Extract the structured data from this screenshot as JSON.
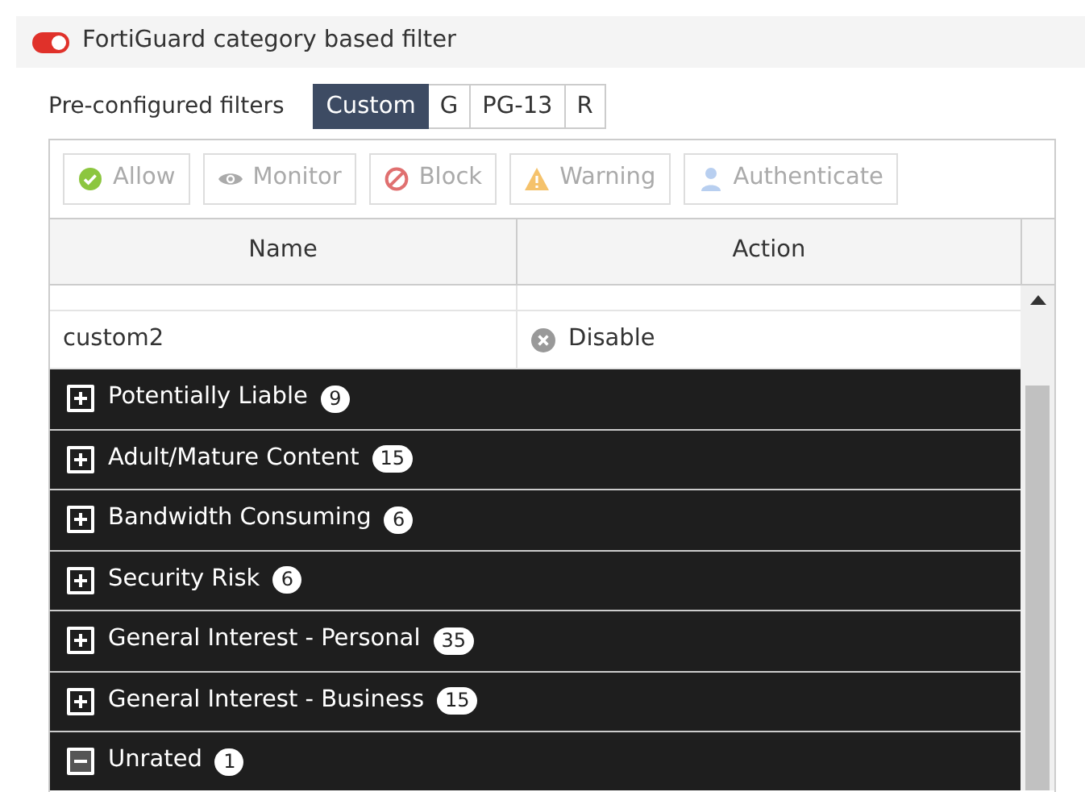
{
  "filter_toggle": {
    "label": "FortiGuard category based filter",
    "on": true
  },
  "preconfigured": {
    "label": "Pre-configured filters",
    "options": [
      {
        "label": "Custom",
        "selected": true
      },
      {
        "label": "G",
        "selected": false
      },
      {
        "label": "PG-13",
        "selected": false
      },
      {
        "label": "R",
        "selected": false
      }
    ]
  },
  "toolbar": [
    {
      "label": "Allow",
      "kind": "allow",
      "disabled": true
    },
    {
      "label": "Monitor",
      "kind": "monitor",
      "disabled": true
    },
    {
      "label": "Block",
      "kind": "block",
      "disabled": true
    },
    {
      "label": "Warning",
      "kind": "warning",
      "disabled": true
    },
    {
      "label": "Authenticate",
      "kind": "authenticate",
      "disabled": true
    }
  ],
  "table": {
    "columns": [
      "Name",
      "Action"
    ],
    "rows": [
      {
        "name": "custom2",
        "action": "Disable"
      }
    ],
    "groups": [
      {
        "label": "Potentially Liable",
        "count": "9",
        "expanded": false
      },
      {
        "label": "Adult/Mature Content",
        "count": "15",
        "expanded": false
      },
      {
        "label": "Bandwidth Consuming",
        "count": "6",
        "expanded": false
      },
      {
        "label": "Security Risk",
        "count": "6",
        "expanded": false
      },
      {
        "label": "General Interest - Personal",
        "count": "35",
        "expanded": false
      },
      {
        "label": "General Interest - Business",
        "count": "15",
        "expanded": false
      },
      {
        "label": "Unrated",
        "count": "1",
        "expanded": true
      }
    ]
  }
}
